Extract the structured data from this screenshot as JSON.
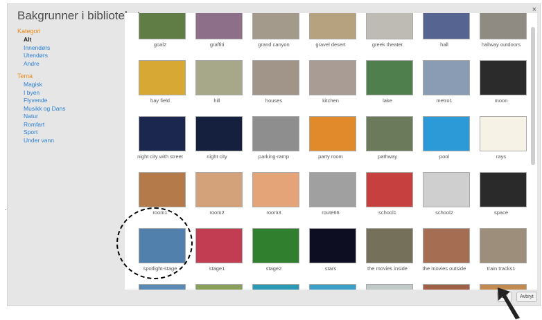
{
  "dialog": {
    "title": "Bakgrunner i biblioteket",
    "close_label": "×"
  },
  "sidebar": {
    "category_header": "Kategori",
    "categories": [
      "Alt",
      "Innendørs",
      "Utendørs",
      "Andre"
    ],
    "theme_header": "Tema",
    "themes": [
      "Magisk",
      "I byen",
      "Flyvende",
      "Musikk og Dans",
      "Natur",
      "Romfart",
      "Sport",
      "Under vann"
    ]
  },
  "library": {
    "rows": [
      [
        "goal2",
        "graffiti",
        "grand canyon",
        "gravel desert",
        "greek theater",
        "hall",
        "hallway outdoors"
      ],
      [
        "hay field",
        "hill",
        "houses",
        "kitchen",
        "lake",
        "metro1",
        "moon"
      ],
      [
        "night city with street",
        "night city",
        "parking-ramp",
        "party room",
        "pathway",
        "pool",
        "rays"
      ],
      [
        "room1",
        "room2",
        "room3",
        "route66",
        "school1",
        "school2",
        "space"
      ],
      [
        "spotlight-stage",
        "stage1",
        "stage2",
        "stars",
        "the movies inside",
        "the movies outside",
        "train tracks1"
      ],
      [
        "",
        "",
        "",
        "",
        "",
        "",
        ""
      ]
    ],
    "thumb_colors": [
      [
        "#5f7d45",
        "#8d6f8a",
        "#a49a8c",
        "#b6a27e",
        "#bdbbb4",
        "#556490",
        "#8f8b83"
      ],
      [
        "#d8a835",
        "#a7a78a",
        "#a19488",
        "#a89c94",
        "#4f7f4c",
        "#8a9cb4",
        "#2b2b2b"
      ],
      [
        "#1c2750",
        "#15203f",
        "#8e8e8e",
        "#e08a2c",
        "#6a7a5a",
        "#2c9ad6",
        "#f6f2e6"
      ],
      [
        "#b57a4a",
        "#d4a27a",
        "#e4a478",
        "#a0a0a0",
        "#c64040",
        "#cfcfcf",
        "#2a2a2a"
      ],
      [
        "#5280ad",
        "#c23c52",
        "#2f7f2f",
        "#0e0e22",
        "#75705a",
        "#a56e52",
        "#9c8e7a"
      ],
      [
        "#5a8ab4",
        "#8aa05a",
        "#2a9ab4",
        "#3aa0c8",
        "#c0c8c8",
        "#a06048",
        "#c08a50"
      ]
    ]
  },
  "buttons": {
    "ok": "OK",
    "cancel": "Avbryt"
  }
}
